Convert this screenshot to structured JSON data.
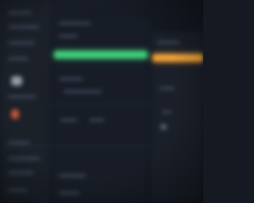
{
  "theme": {
    "background": "#151922",
    "sidebar": "#1b2029",
    "panel": "#171c26",
    "accent_green": "#3ecf7a",
    "accent_orange": "#f2a23a",
    "text_muted": "#4a5366"
  },
  "main": {
    "progress_green": {
      "color_name": "green",
      "fill": 1.0
    },
    "progress_orange": {
      "color_name": "orange",
      "fill": 1.0
    }
  },
  "icons": [
    "app-icon",
    "flame-icon"
  ]
}
